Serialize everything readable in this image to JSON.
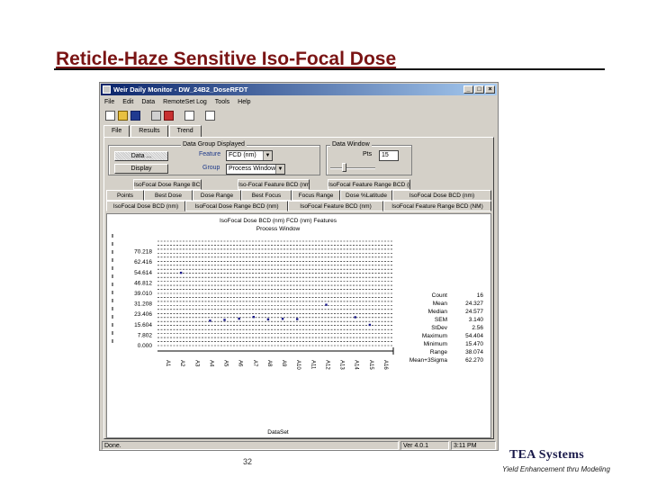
{
  "slide": {
    "title": "Reticle-Haze Sensitive Iso-Focal Dose",
    "page_number": "32",
    "logo": "TEA Systems",
    "tagline": "Yield Enhancement thru Modeling"
  },
  "window": {
    "title": "Weir Daily Monitor - DW_24B2_DoseRFDT",
    "buttons": [
      "_",
      "□",
      "×"
    ],
    "menu": [
      "File",
      "Edit",
      "Data",
      "RemoteSet Log",
      "Tools",
      "Help"
    ],
    "toolbar_icons": [
      "new-icon",
      "open-icon",
      "save-icon",
      "print-icon",
      "red-icon",
      "cut-icon",
      "help-icon"
    ],
    "tabs": [
      "File",
      "Results",
      "Trend"
    ],
    "active_tab": "Trend",
    "data_group": {
      "title": "Data Group Displayed",
      "button_1": "Data ...",
      "button_2": "Display",
      "feature_label": "Feature",
      "feature_value": "FCD (nm)",
      "group_label": "Group",
      "group_value": "Process Window"
    },
    "data_window": {
      "title": "Data Window",
      "points_label": "Pts",
      "points_value": "15",
      "slider_level": 0.3
    },
    "subtab_rows": [
      [
        "IsoFocal Dose Range BCD (nm)",
        "Iso-Focal Feature BCD (nm)",
        "IsoFocal Feature Range BCD (nm)"
      ],
      [
        "Points",
        "Best Dose",
        "Dose Range",
        "Best Focus",
        "Focus Range",
        "Dose %Latitude",
        "IsoFocal Dose BCD (nm)"
      ],
      [
        "IsoFocal Dose BCD (nm)",
        "IsoFocal Dose Range BCD (nm)",
        "IsoFocal Feature BCD (nm)",
        "IsoFocal Feature Range BCD (NM)"
      ]
    ],
    "status": {
      "left": "Done.",
      "version": "Ver 4.0.1",
      "time": "3:11 PM"
    }
  },
  "chart_data": {
    "type": "scatter",
    "title": "IsoFocal Dose BCD (nm) FCD (nm) Features",
    "subtitle": "Process Window",
    "xlabel": "DataSet",
    "y_tick_labels": [
      "70.218",
      "62.416",
      "54.614",
      "46.812",
      "39.010",
      "31.208",
      "23.406",
      "15.604",
      "7.802",
      "0.000"
    ],
    "ylim": [
      0,
      78.02
    ],
    "x_count": 16,
    "x_labels": [
      "A1",
      "A2",
      "A3",
      "A4",
      "A5",
      "A6",
      "A7",
      "A8",
      "A9",
      "A10",
      "A11",
      "A12",
      "A13",
      "A14",
      "A15",
      "A16"
    ],
    "values": [
      null,
      54.4,
      null,
      18.6,
      19.2,
      20.1,
      21.4,
      19.6,
      20.0,
      19.8,
      null,
      30.5,
      null,
      21.2,
      15.5,
      null
    ],
    "stats_labels": [
      "Count",
      "Mean",
      "Median",
      "SEM",
      "StDev",
      "Maximum",
      "Minimum",
      "Range",
      "Mean+3Sigma"
    ],
    "stats_values": [
      "16",
      "24.327",
      "24.577",
      "3.140",
      "2.56",
      "54.404",
      "15.470",
      "38.074",
      "62.270"
    ],
    "grid": true
  }
}
